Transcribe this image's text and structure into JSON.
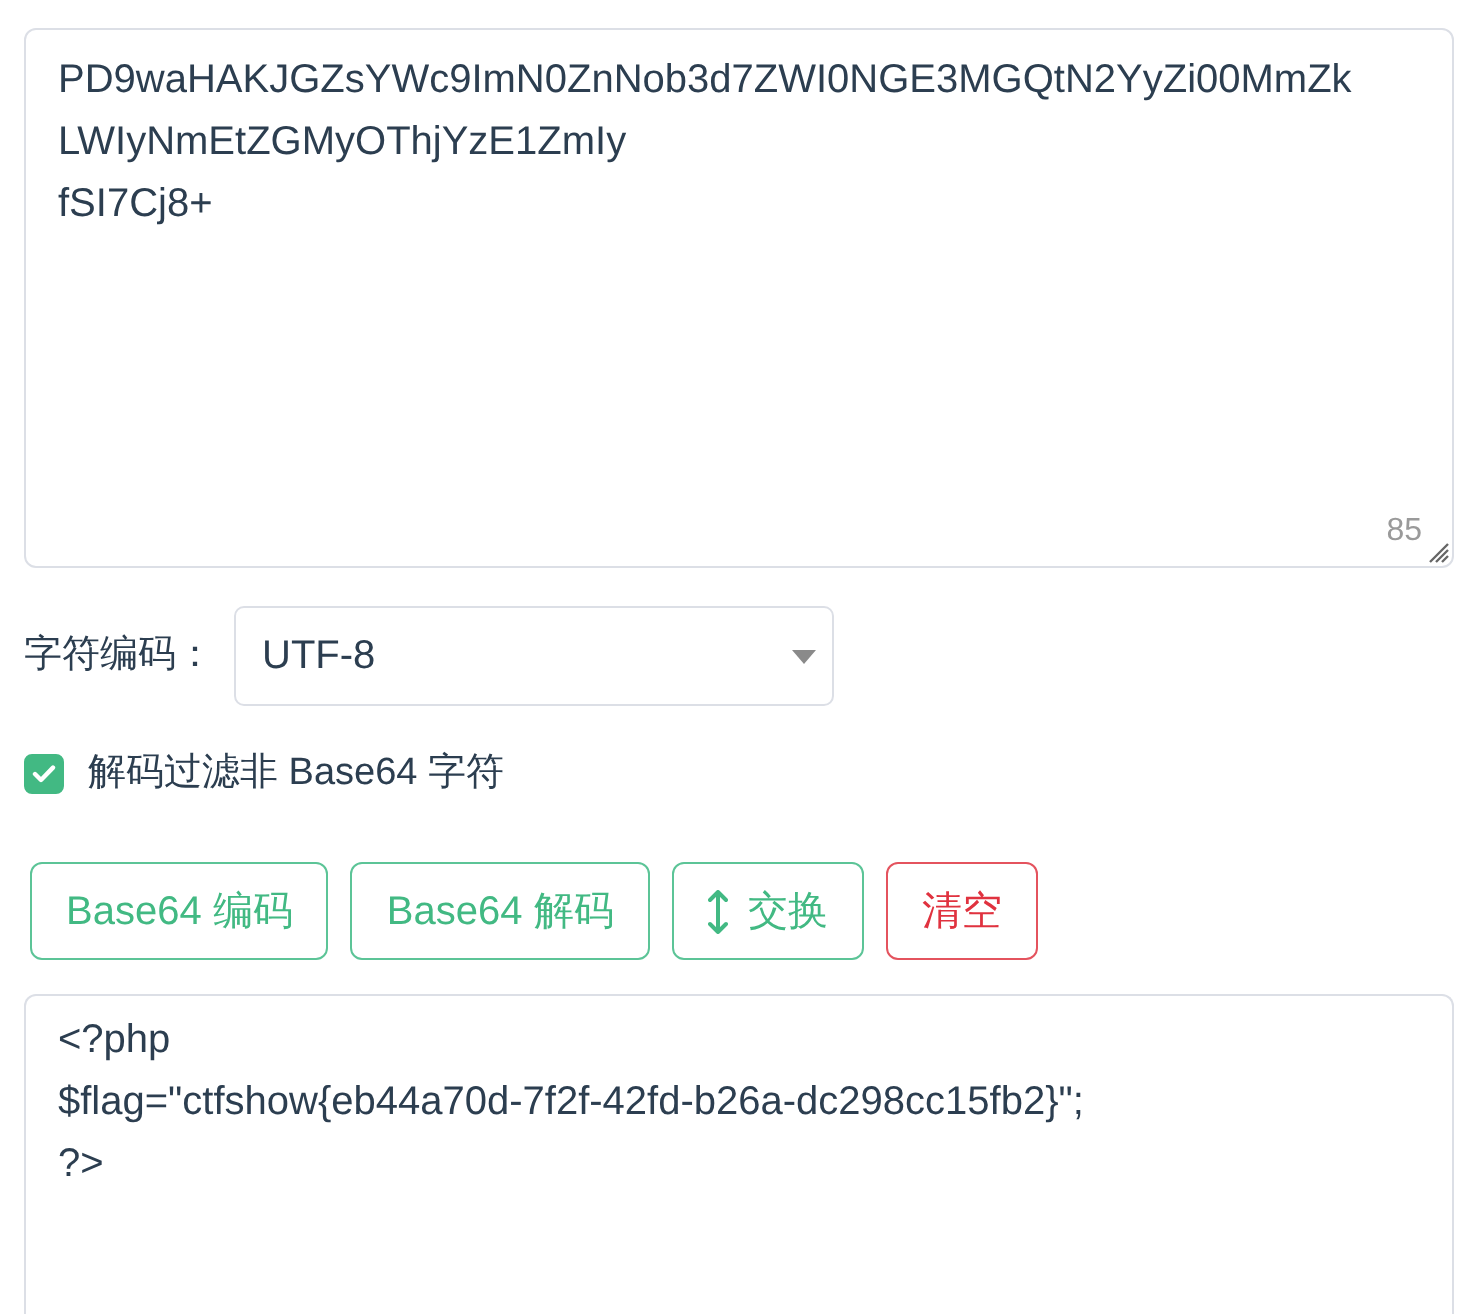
{
  "input": {
    "lines": [
      "PD9waHAKJGZsYWc9ImN0ZnNob3d7ZWI0NGE3MGQtN2YyZi00MmZk",
      "LWIyNmEtZGMyOThjYzE1ZmIy",
      "fSI7Cj8+"
    ],
    "char_count": "85"
  },
  "encoding": {
    "label": "字符编码：",
    "value": "UTF-8"
  },
  "filter_option": {
    "label": "解码过滤非 Base64 字符",
    "checked": true
  },
  "buttons": [
    {
      "label": "Base64 编码",
      "kind": "action"
    },
    {
      "label": "Base64 解码",
      "kind": "action"
    },
    {
      "label": "交换",
      "kind": "swap"
    },
    {
      "label": "清空",
      "kind": "danger"
    }
  ],
  "output": {
    "lines": [
      "<?php",
      "$flag=\"ctfshow{eb44a70d-7f2f-42fd-b26a-dc298cc15fb2}\";",
      "?>"
    ]
  }
}
